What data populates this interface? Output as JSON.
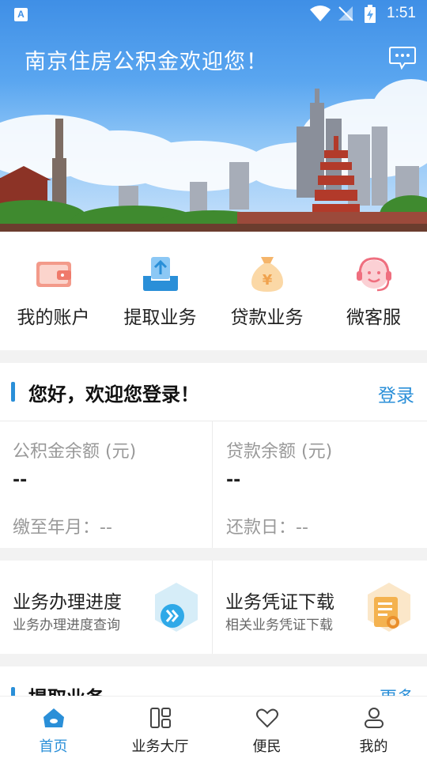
{
  "status_bar": {
    "time": "1:51",
    "app_icon_letter": "A"
  },
  "header": {
    "title": "南京住房公积金欢迎您！"
  },
  "quick_actions": [
    {
      "label": "我的账户",
      "icon": "wallet-icon"
    },
    {
      "label": "提取业务",
      "icon": "withdraw-tray-icon"
    },
    {
      "label": "贷款业务",
      "icon": "money-bag-icon"
    },
    {
      "label": "微客服",
      "icon": "headset-service-icon"
    }
  ],
  "welcome": {
    "title": "您好，欢迎您登录！",
    "login_label": "登录",
    "fund_balance_label": "公积金余额 (元)",
    "fund_balance_value": "--",
    "paid_until_label": "缴至年月：--",
    "loan_balance_label": "贷款余额 (元)",
    "loan_balance_value": "--",
    "repay_day_label": "还款日：--"
  },
  "services": [
    {
      "title": "业务办理进度",
      "subtitle": "业务办理进度查询",
      "icon": "progress-forward-icon"
    },
    {
      "title": "业务凭证下载",
      "subtitle": "相关业务凭证下载",
      "icon": "certificate-document-icon"
    }
  ],
  "next_section": {
    "title": "提取业务",
    "more_label": "更多"
  },
  "bottom_nav": [
    {
      "label": "首页",
      "icon": "home-icon",
      "active": true
    },
    {
      "label": "业务大厅",
      "icon": "hall-grid-icon",
      "active": false
    },
    {
      "label": "便民",
      "icon": "heart-icon",
      "active": false
    },
    {
      "label": "我的",
      "icon": "profile-icon",
      "active": false
    }
  ],
  "colors": {
    "accent": "#2a8fd8",
    "hero_top": "#3f8fe6",
    "icon_orange": "#f0a24d",
    "icon_red": "#ef7a6b"
  }
}
